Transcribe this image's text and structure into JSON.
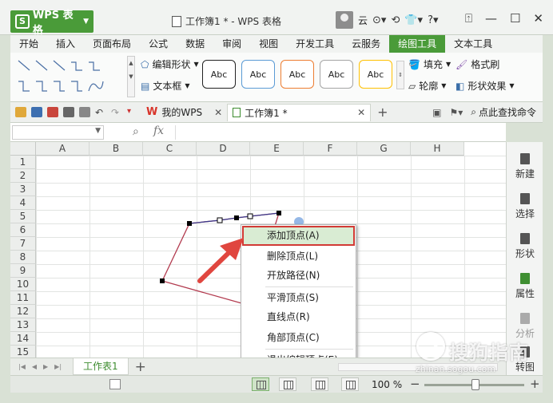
{
  "app": {
    "name": "WPS 表格",
    "doc_title": "工作簿1 * - WPS 表格",
    "user": "云"
  },
  "tabs": [
    "开始",
    "插入",
    "页面布局",
    "公式",
    "数据",
    "审阅",
    "视图",
    "开发工具",
    "云服务",
    "绘图工具",
    "文本工具"
  ],
  "active_tab": "绘图工具",
  "ribbon": {
    "edit_shape": "编辑形状",
    "text_box": "文本框",
    "style_label": "Abc",
    "fill": "填充",
    "format_painter": "格式刷",
    "outline": "轮廓",
    "shape_effect": "形状效果",
    "style_colors": [
      "#222222",
      "#5b9bd5",
      "#ed7d31",
      "#a5a5a5",
      "#ffc000"
    ]
  },
  "quickbar": {
    "my_wps": "我的WPS",
    "doc_tab": "工作簿1 *",
    "search": "点此查找命令"
  },
  "formula_bar": {
    "fx": "fx"
  },
  "grid": {
    "columns": [
      "A",
      "B",
      "C",
      "D",
      "E",
      "F",
      "G",
      "H"
    ],
    "rows": [
      "1",
      "2",
      "3",
      "4",
      "5",
      "6",
      "7",
      "8",
      "9",
      "10",
      "11",
      "12",
      "13",
      "14",
      "15"
    ]
  },
  "context_menu": [
    {
      "label": "添加顶点(A)",
      "highlighted": true
    },
    {
      "label": "删除顶点(L)"
    },
    {
      "label": "开放路径(N)"
    },
    {
      "label": "平滑顶点(S)"
    },
    {
      "label": "直线点(R)"
    },
    {
      "label": "角部顶点(C)"
    },
    {
      "label": "退出编辑顶点(E)"
    }
  ],
  "task_pane": [
    "新建",
    "选择",
    "形状",
    "属性",
    "分析",
    "转图"
  ],
  "sheet_tabs": [
    "工作表1"
  ],
  "status": {
    "zoom": "100 %"
  },
  "watermark": {
    "brand": "搜狗指南",
    "url": "zhinan.sogou.com"
  }
}
